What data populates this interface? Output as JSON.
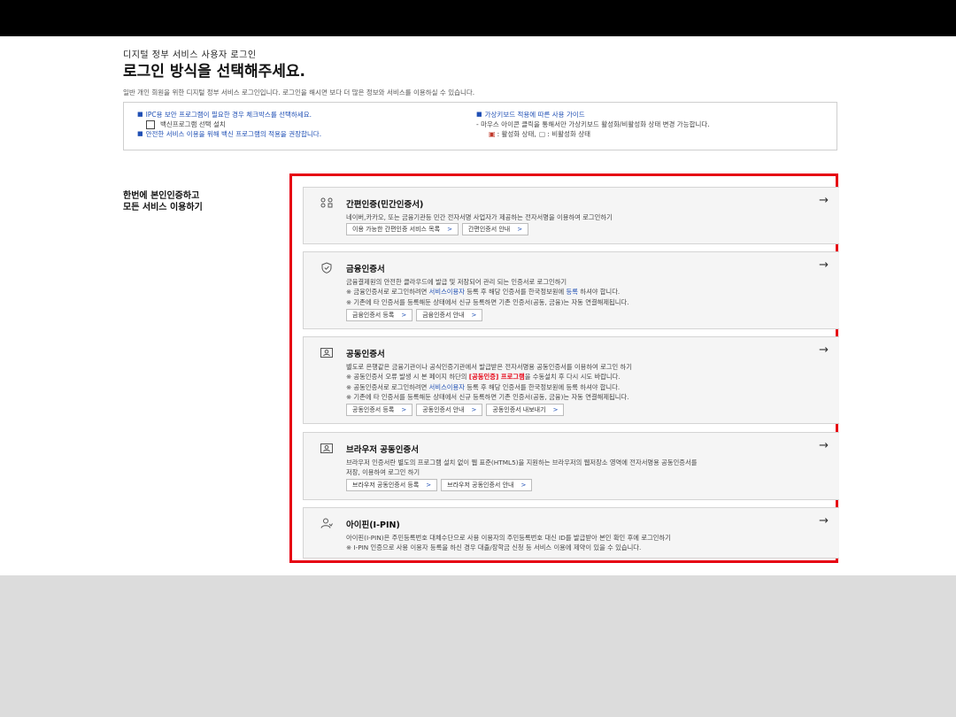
{
  "header": {
    "subtitle": "디지털 정부 서비스 사용자 로그인",
    "title": "로그인 방식을 선택해주세요.",
    "description": "일반 개인 회원을 위한 디지털 정부 서비스 로그인입니다. 로그인을 해시면 보다 더 많은 정보와 서비스를 이용하실 수 있습니다."
  },
  "notice": {
    "left": {
      "line1": "IPC용 보안 프로그램이 필요한 경우 체크박스를 선택하세요.",
      "checkbox_label": "백신프로그램 선택 설치",
      "line3": "안전한 서비스 이용을 위해 백신 프로그램의 적용을 권장합니다."
    },
    "right": {
      "line1": "가상키보드 적용에 따른 사용 가이드",
      "line2": "- 마우스 아이콘 클릭을 통해서만 가상키보드 활성화/비활성화 상태 변경 가능합니다.",
      "on_label": ": 활성화 상태,",
      "off_label": ": 비활성화 상태"
    }
  },
  "side_title": {
    "line1": "한번에 본인인증하고",
    "line2": "모든 서비스 이용하기"
  },
  "arrow": "→",
  "chevron": ">",
  "methods": [
    {
      "icon": "simple-auth-icon",
      "title": "간편인증(민간인증서)",
      "lines": [
        "네이버,카카오, 또는 금융기관등 민간 전자서명 사업자가 제공하는 전자서명을 이용하여 로그인하기"
      ],
      "buttons": [
        "이용 가능한 간편인증 서비스 목록",
        "간편인증서 안내"
      ]
    },
    {
      "icon": "shield-icon",
      "title": "금융인증서",
      "line1": "금융결제원의 안전한 클라우드에 발급 및 저장되어 관리 되는 인증서로 로그인하기",
      "line2_a": "※ 금융인증서로 로그인하려면 ",
      "line2_b": "서비스이용자",
      "line2_c": " 등록 후 해당 인증서를 한국정보원에 ",
      "line2_d": "등록",
      "line2_e": " 하셔야 합니다.",
      "line3": "※ 기존에 타 인증서를 등록해둔 상태에서 신규 등록하면 기존 인증서(공동, 금융)는 자동 연결해제됩니다.",
      "buttons": [
        "금융인증서 등록",
        "금융인증서 안내"
      ]
    },
    {
      "icon": "certificate-icon",
      "title": "공동인증서",
      "line1": "별도로 은행같은 금융기관이나 공식인증기관에서 발급받은 전자서명용 공동인증서를 이용하여 로그인 하기",
      "line2_a": "※ 공동인증서 오류 발생 시 본 페이지 하단의 ",
      "line2_b": "[공동인증] 프로그램",
      "line2_c": "을 수동설치 후 다시 시도 바랍니다.",
      "line3_a": "※ 공동인증서로 로그인하려면 ",
      "line3_b": "서비스이용자",
      "line3_c": " 등록 후 해당 인증서를 한국정보원에 등록 하셔야 합니다.",
      "line4": "※ 기존에 타 인증서를 등록해둔 상태에서 신규 등록하면 기존 인증서(공동, 금융)는 자동 연결해제됩니다.",
      "buttons": [
        "공동인증서 등록",
        "공동인증서 안내",
        "공동인증서 내보내기"
      ]
    },
    {
      "icon": "browser-certificate-icon",
      "title": "브라우저 공동인증서",
      "lines": [
        "브라우저 인증서란 별도의 프로그램 설치 없이 웹 표준(HTML5)을 지원하는 브라우저의 웹저장소 영역에 전자서명용 공동인증서를",
        "저장, 이용하여 로그인 하기"
      ],
      "buttons": [
        "브라우저 공동인증서 등록",
        "브라우저 공동인증서 안내"
      ]
    },
    {
      "icon": "person-icon",
      "title": "아이핀(I-PIN)",
      "lines": [
        "아이핀(I-PIN)은 주민등록번호 대체수단으로 사용 이용자의 주민등록번호 대신 ID를 발급받아 본인 확인 후에 로그인하기",
        "※ I-PIN 인증으로 사용 이용자 등록을 하신 경우 대출/장학금 신청 등 서비스 이용에 제약이 있을 수 있습니다."
      ],
      "buttons": []
    }
  ]
}
